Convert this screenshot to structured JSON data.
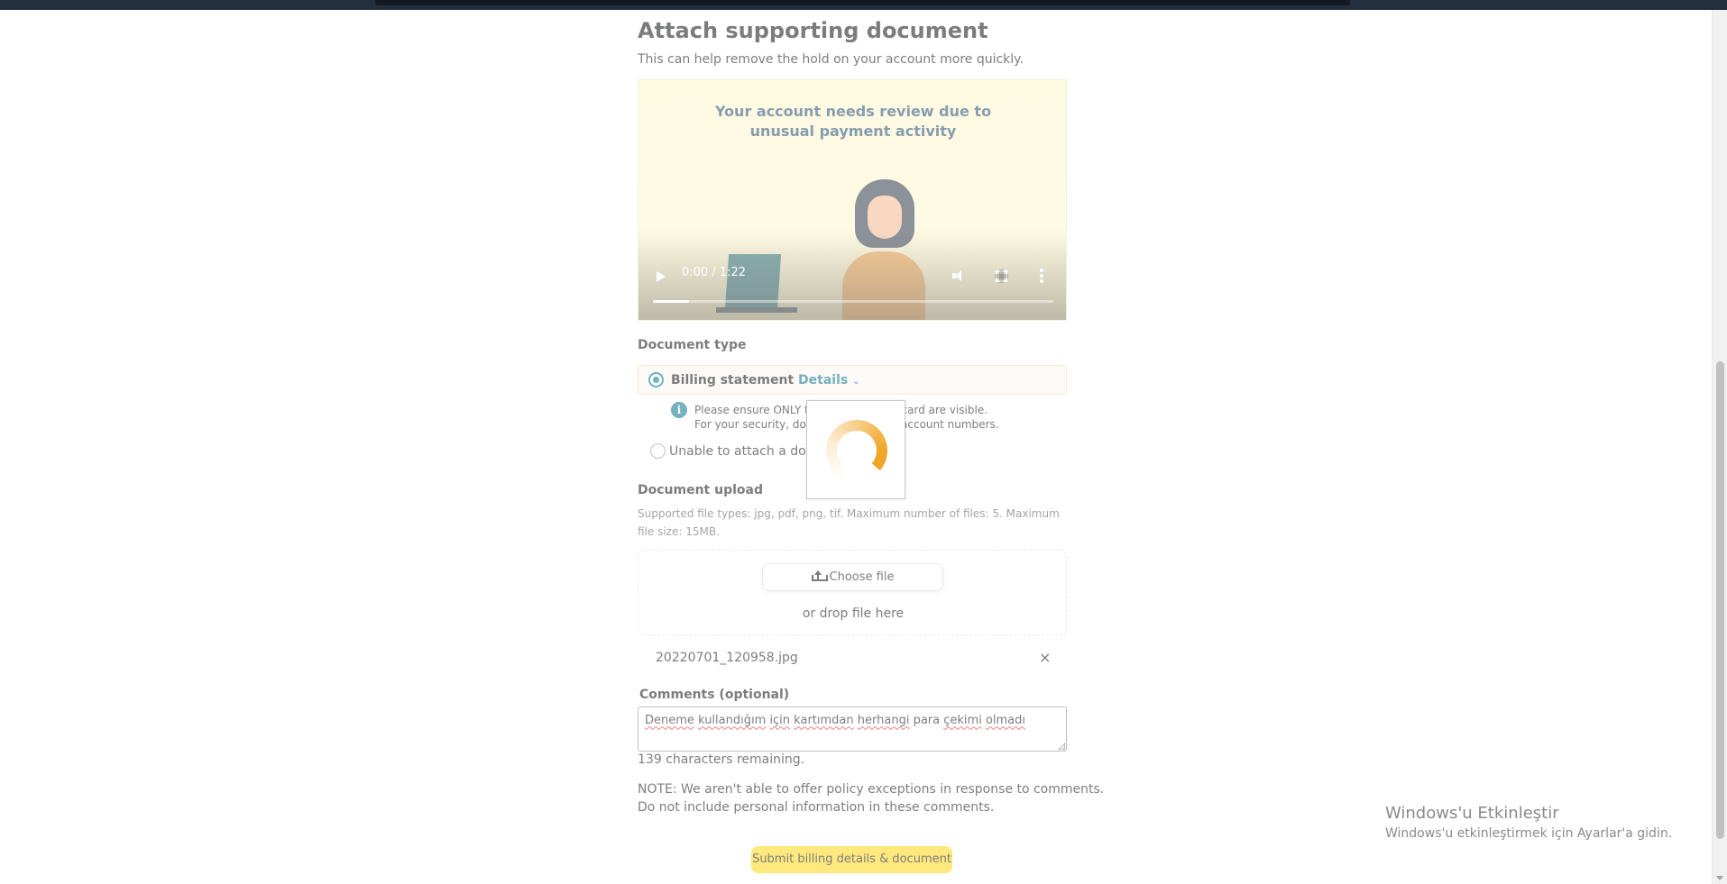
{
  "page": {
    "title": "Attach supporting document",
    "subtitle": "This can help remove the hold on your account more quickly."
  },
  "video": {
    "title_line1": "Your account needs review due to",
    "title_line2": "unusual payment activity",
    "time": "0:00 / 1:22",
    "progress": 0.09
  },
  "document_type": {
    "label": "Document type",
    "options": [
      {
        "label": "Billing statement",
        "details_link": "Details",
        "selected": true
      },
      {
        "label": "Unable to attach a docu",
        "selected": false
      }
    ],
    "info_line1": "Please ensure ONLY th                    he card are visible.",
    "info_line2": "For your security, do N                    or account numbers."
  },
  "upload": {
    "label": "Document upload",
    "supported": "Supported file types: jpg, pdf, png, tif. Maximum number of files: 5. Maximum file size: 15MB.",
    "choose_button": "Choose file",
    "drop_text": "or drop file here",
    "file_name": "20220701_120958.jpg",
    "remove": "×"
  },
  "comments": {
    "label": "Comments (optional)",
    "value_words": [
      "Deneme",
      "kullandığım",
      "için",
      "kartımdan",
      "herhangi",
      "para",
      "çekimi",
      "olmadı"
    ],
    "remaining": "139 characters remaining."
  },
  "note": {
    "line1": "NOTE: We aren't able to offer policy exceptions in response to comments.",
    "line2": "Do not include personal information in these comments."
  },
  "submit_button": "Submit billing details & document",
  "watermark": {
    "title": "Windows'u Etkinleştir",
    "subtitle": "Windows'u etkinleştirmek için Ayarlar'a gidin."
  },
  "colors": {
    "link": "#007185",
    "submit": "#ffd814",
    "spinner": "#f0a628",
    "selected_bg": "#fcf5ee"
  }
}
